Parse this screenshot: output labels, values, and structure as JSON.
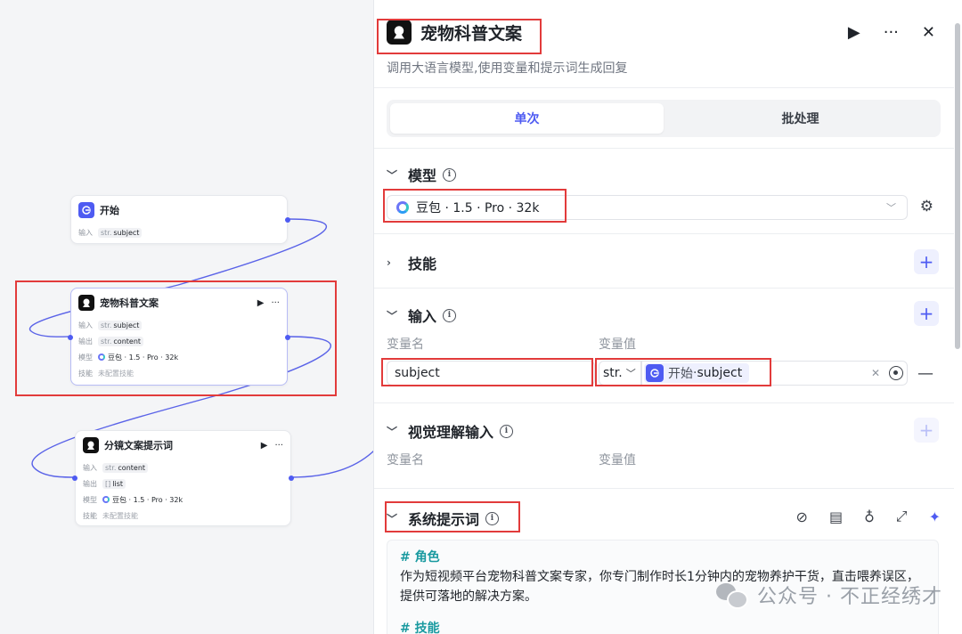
{
  "canvas": {
    "nodes": [
      {
        "title": "开始",
        "rows": [
          {
            "label": "输入",
            "type": "str.",
            "value": "subject"
          }
        ]
      },
      {
        "title": "宠物科普文案",
        "rows": [
          {
            "label": "输入",
            "type": "str.",
            "value": "subject"
          },
          {
            "label": "输出",
            "type": "str.",
            "value": "content"
          },
          {
            "label": "模型",
            "model": "豆包 · 1.5 · Pro · 32k"
          },
          {
            "label": "技能",
            "empty": "未配置技能"
          }
        ]
      },
      {
        "title": "分镜文案提示词",
        "rows": [
          {
            "label": "输入",
            "type": "str.",
            "value": "content"
          },
          {
            "label": "输出",
            "type": "[]",
            "value": "list"
          },
          {
            "label": "模型",
            "model": "豆包 · 1.5 · Pro · 32k"
          },
          {
            "label": "技能",
            "empty": "未配置技能"
          }
        ]
      }
    ]
  },
  "panel": {
    "title": "宠物科普文案",
    "description": "调用大语言模型,使用变量和提示词生成回复",
    "tabs": [
      "单次",
      "批处理"
    ],
    "active_tab": "单次",
    "model_section": {
      "title": "模型",
      "selected": "豆包 · 1.5 · Pro · 32k"
    },
    "skills_section": {
      "title": "技能"
    },
    "input_section": {
      "title": "输入",
      "col_name": "变量名",
      "col_value": "变量值",
      "var_name": "subject",
      "var_type": "str.",
      "ref_node": "开始",
      "ref_sep": " · ",
      "ref_var": "subject"
    },
    "vision_section": {
      "title": "视觉理解输入",
      "col_name": "变量名",
      "col_value": "变量值"
    },
    "system_prompt": {
      "title": "系统提示词",
      "heading1": "# 角色",
      "body1": "作为短视频平台宠物科普文案专家，你专门制作时长1分钟内的宠物养护干货，直击喂养误区，提供可落地的解决方案。",
      "heading2": "# 技能"
    },
    "watermark": "公众号 · 不正经绣才"
  },
  "colors": {
    "accent": "#4e5bf2",
    "highlight": "#e23b3b",
    "prompt_heading": "#1a9aa0"
  },
  "icons": [
    "play-icon",
    "more-icon",
    "close-icon",
    "info-icon",
    "chevron-down-icon",
    "chevron-right-icon",
    "plus-icon",
    "gear-icon",
    "clear-icon",
    "target-icon",
    "minus-icon",
    "compass-icon",
    "library-icon",
    "bulb-icon",
    "expand-icon",
    "sparkle-icon"
  ]
}
